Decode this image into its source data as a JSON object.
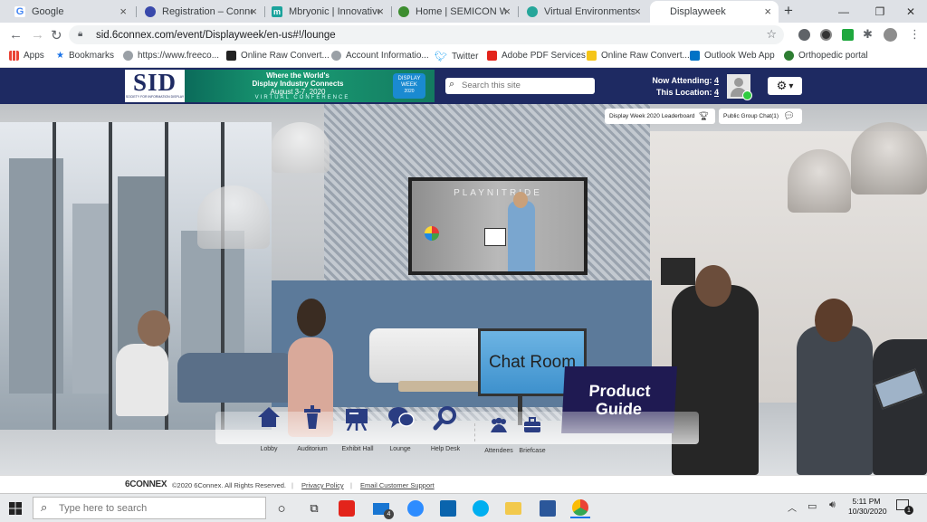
{
  "browser": {
    "tabs": [
      {
        "title": "Google",
        "icon": "google-icon",
        "color": "#4285f4"
      },
      {
        "title": "Registration – Connecti",
        "icon": "registration-favicon",
        "color": "#3949ab"
      },
      {
        "title": "Mbryonic | Innovative V",
        "icon": "mbryonic-favicon",
        "color": "#1ba39c"
      },
      {
        "title": "Home | SEMICON West",
        "icon": "semicon-favicon",
        "color": "#3c8d2f"
      },
      {
        "title": "Virtual Environments Pl",
        "icon": "virtual-env-favicon",
        "color": "#26a69a"
      },
      {
        "title": "Displayweek",
        "icon": "",
        "color": "#ffffff"
      }
    ],
    "new_tab_glyph": "+",
    "close_glyph": "×",
    "window_controls": {
      "minimize": "—",
      "maximize": "❐",
      "close": "✕"
    },
    "address": "sid.6connex.com/event/Displayweek/en-us#!/lounge",
    "bookmarks": [
      {
        "label": "Apps",
        "color": "#ea4335"
      },
      {
        "label": "Bookmarks",
        "color": "#1a73e8"
      },
      {
        "label": "https://www.freeco...",
        "color": "#5f6368"
      },
      {
        "label": "Online Raw Convert...",
        "color": "#222222"
      },
      {
        "label": "Account Informatio...",
        "color": "#5f6368"
      },
      {
        "label": "Twitter",
        "color": "#1da1f2"
      },
      {
        "label": "Adobe PDF Services",
        "color": "#e3241b"
      },
      {
        "label": "Online Raw Convert...",
        "color": "#f5c518"
      },
      {
        "label": "Outlook Web App",
        "color": "#0072c6"
      },
      {
        "label": "Orthopedic portal",
        "color": "#2e7d32"
      }
    ]
  },
  "site": {
    "logo": "SID",
    "logo_sub": "SOCIETY FOR INFORMATION DISPLAY",
    "banner_line1": "Where the World's",
    "banner_line2": "Display Industry Connects",
    "banner_dates": "August 3-7, 2020",
    "banner_tag": "VIRTUAL CONFERENCE",
    "badge_line1": "DISPLAY",
    "badge_line2": "WEEK",
    "badge_year": "2020",
    "search_placeholder": "Search this site",
    "now_attending_label": "Now Attending:",
    "now_attending_value": "4",
    "this_location_label": "This Location:",
    "this_location_value": "4",
    "settings_caret": "▾"
  },
  "scene": {
    "leaderboard_label": "Display Week 2020 Leaderboard",
    "group_chat_label": "Public Group Chat(1)",
    "screen_brand": "PLAYNITRIDE",
    "chat_room_label": "Chat Room",
    "product_guide_line1": "Product",
    "product_guide_line2": "Guide",
    "nav": [
      {
        "label": "Lobby",
        "icon": "lobby-home-icon"
      },
      {
        "label": "Auditorium",
        "icon": "auditorium-podium-icon"
      },
      {
        "label": "Exhibit Hall",
        "icon": "exhibit-hall-icon"
      },
      {
        "label": "Lounge",
        "icon": "lounge-chat-icon"
      },
      {
        "label": "Help Desk",
        "icon": "help-desk-search-icon"
      },
      {
        "label": "Attendees",
        "icon": "attendees-icon"
      },
      {
        "label": "Briefcase",
        "icon": "briefcase-icon"
      }
    ]
  },
  "footer": {
    "brand": "6CONNEX",
    "copyright": "©2020 6Connex. All Rights Reserved.",
    "privacy": "Privacy Policy",
    "email": "Email Customer Support"
  },
  "taskbar": {
    "search_placeholder": "Type here to search",
    "mail_badge": "4",
    "time": "5:11 PM",
    "date": "10/30/2020",
    "notification_count": "1"
  }
}
